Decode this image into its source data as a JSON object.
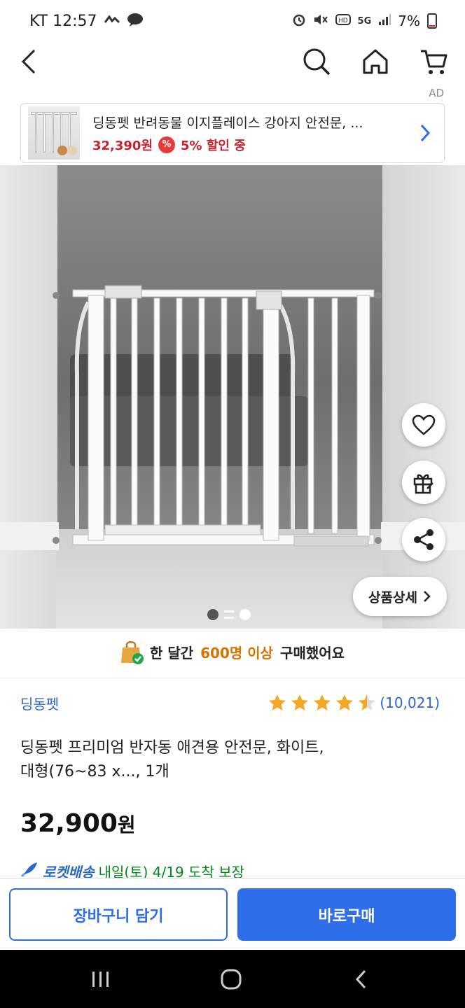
{
  "status_bar": {
    "carrier_time": "KT 12:57",
    "network": "5G",
    "battery": "7%"
  },
  "ad": {
    "label": "AD",
    "title": "딩동펫 반려동물 이지플레이스 강아지 안전문, ...",
    "price": "32,390원",
    "discount": "5% 할인 중"
  },
  "image": {
    "detail_label": "상품상세"
  },
  "purchase_note": {
    "prefix": "한 달간",
    "highlight": "600명 이상",
    "suffix": "구매했어요"
  },
  "product": {
    "brand": "딩동펫",
    "rating": 4.5,
    "review_count": "(10,021)",
    "title_line1": "딩동펫 프리미엄 반자동 애견용 안전문, 화이트,",
    "title_line2": "대형(76~83 x..., 1개",
    "price_number": "32,900",
    "price_unit": "원",
    "delivery_label": "로켓배송",
    "delivery_text": "내일(토) 4/19 도착 보장"
  },
  "actions": {
    "cart_label": "장바구니 담기",
    "buy_label": "바로구매"
  },
  "colors": {
    "accent": "#2e6ee8",
    "price_red": "#c8232c",
    "highlight_orange": "#d97300",
    "star": "#f5a623"
  }
}
